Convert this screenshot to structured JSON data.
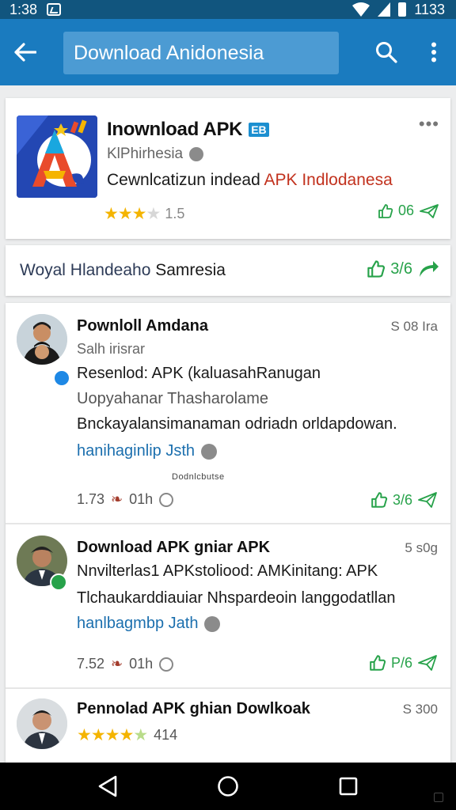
{
  "status_bar": {
    "time": "1:38",
    "clock_right": "1133"
  },
  "app_bar": {
    "search_text": "Download Anidonesia"
  },
  "app_card": {
    "title": "Inownload APK",
    "badge": "EB",
    "publisher": "KlPhirhesia",
    "description_plain": "Cewnlcatizun indead ",
    "description_highlight": "APK Indlodanesa",
    "rating": "1.5",
    "action_count": "06",
    "menu": "•••"
  },
  "promo": {
    "text_a": "Woyal Hlandeaho ",
    "text_b": "Samresia",
    "count": "3/6"
  },
  "posts": [
    {
      "name": "Pownloll Amdana",
      "time": "S 08 Ira",
      "subtitle": "Salh irisrar",
      "lines": [
        "Resenlod: APK (kaluasahRanugan",
        "Uopyahanar Thasharolame",
        "Bnckayalansimanaman odriadn orldapdowan."
      ],
      "link": "hanihaginlip Jsth",
      "caption": "Dodnlcbutse",
      "stat": "1.73",
      "stat2": "01h",
      "count": "3/6"
    },
    {
      "name": "Download APK gniar APK",
      "time": "5 s0g",
      "lines": [
        "Nnvilterlas1 APKstoliood: AMKinitang: APK",
        "Tlchaukarddiauiar Nhspardeoin langgodatllan"
      ],
      "link": "hanlbagmbp Jath",
      "stat": "7.52",
      "stat2": "01h",
      "count": "P/6"
    },
    {
      "name": "Pennolad APK ghian Dowlkoak",
      "time": "S 300",
      "rating": "414"
    }
  ],
  "colors": {
    "status_bar": "#11557e",
    "app_bar": "#1a7bbf",
    "accent_green": "#27a24a",
    "link_blue": "#1b6fae",
    "highlight_red": "#c2321e"
  }
}
